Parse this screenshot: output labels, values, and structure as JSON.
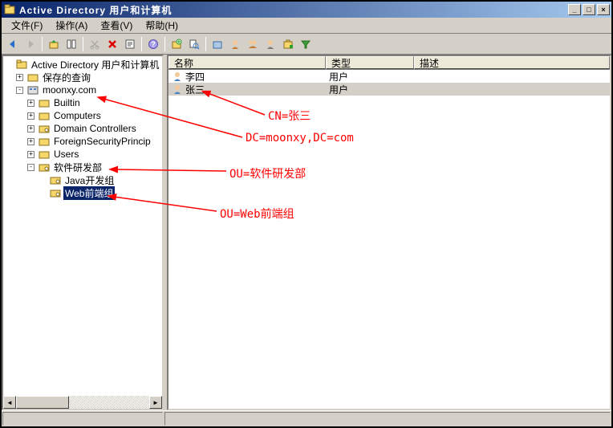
{
  "title": "Active Directory 用户和计算机",
  "menu": {
    "file": "文件(F)",
    "action": "操作(A)",
    "view": "查看(V)",
    "help": "帮助(H)"
  },
  "window_buttons": {
    "min": "_",
    "max": "□",
    "close": "×"
  },
  "tree": {
    "root": "Active Directory 用户和计算机",
    "saved_queries": "保存的查询",
    "domain": "moonxy.com",
    "builtin": "Builtin",
    "computers": "Computers",
    "domain_controllers": "Domain Controllers",
    "fsp": "ForeignSecurityPrincip",
    "users": "Users",
    "ou_rd": "软件研发部",
    "ou_java": "Java开发组",
    "ou_web": "Web前端组"
  },
  "list": {
    "columns": {
      "name": "名称",
      "type": "类型",
      "desc": "描述"
    },
    "rows": [
      {
        "name": "李四",
        "type": "用户",
        "desc": ""
      },
      {
        "name": "张三",
        "type": "用户",
        "desc": ""
      }
    ]
  },
  "annotations": {
    "cn": "CN=张三",
    "dc": "DC=moonxy,DC=com",
    "ou_rd": "OU=软件研发部",
    "ou_web": "OU=Web前端组"
  },
  "toggles": {
    "plus": "+",
    "minus": "-"
  },
  "scroll": {
    "left": "◄",
    "right": "►"
  }
}
